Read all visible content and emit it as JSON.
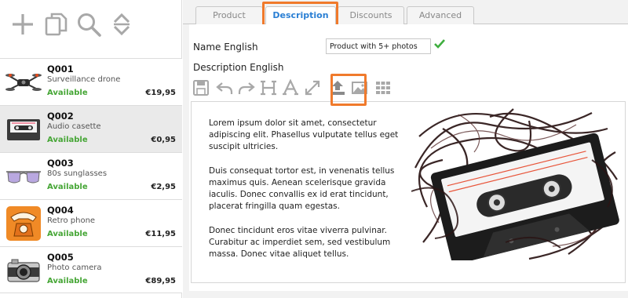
{
  "toolbar_left": {
    "icons": [
      "add-icon",
      "copy-icon",
      "search-icon",
      "sort-icon"
    ]
  },
  "products": [
    {
      "code": "Q001",
      "name": "Surveillance drone",
      "status": "Available",
      "price": "€19,95",
      "icon": "drone-icon"
    },
    {
      "code": "Q002",
      "name": "Audio casette",
      "status": "Available",
      "price": "€0,95",
      "icon": "cassette-icon"
    },
    {
      "code": "Q003",
      "name": "80s sunglasses",
      "status": "Available",
      "price": "€2,95",
      "icon": "sunglasses-icon"
    },
    {
      "code": "Q004",
      "name": "Retro phone",
      "status": "Available",
      "price": "€11,95",
      "icon": "phone-icon"
    },
    {
      "code": "Q005",
      "name": "Photo camera",
      "status": "Available",
      "price": "€89,95",
      "icon": "camera-icon"
    }
  ],
  "tabs": [
    {
      "label": "Product"
    },
    {
      "label": "Description"
    },
    {
      "label": "Discounts"
    },
    {
      "label": "Advanced"
    }
  ],
  "form": {
    "name_label": "Name English",
    "name_value": "Product with 5+ photos",
    "description_label": "Description English"
  },
  "editor_toolbar": {
    "icons": [
      "save-icon",
      "undo-icon",
      "redo-icon",
      "heading-icon",
      "font-icon",
      "fullscreen-icon",
      "upload-icon",
      "image-icon",
      "grid-icon"
    ]
  },
  "description_paragraphs": [
    "Lorem ipsum dolor sit amet, consectetur adipiscing elit. Phasellus vulputate tellus eget suscipit ultricies.",
    "Duis consequat tortor est, in venenatis tellus maximus quis. Aenean scelerisque gravida iaculis. Donec convallis ex id erat tincidunt, placerat fringilla quam egestas.",
    "Donec tincidunt eros vitae viverra pulvinar. Curabitur ac imperdiet sem, sed vestibulum massa. Donec vitae aliquet tellus."
  ],
  "colors": {
    "available": "#46a636",
    "active_tab": "#2a7fd4",
    "highlight": "#f07a2c",
    "check": "#3fae3f",
    "icon_gray": "#a0a0a0"
  }
}
